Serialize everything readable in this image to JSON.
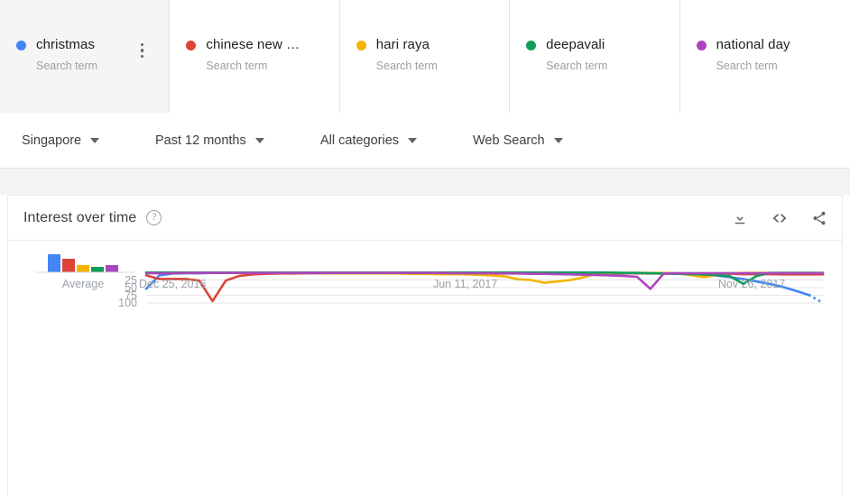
{
  "terms": [
    {
      "label": "christmas",
      "sub": "Search term",
      "color": "#4285F4",
      "selected": true,
      "menu_icon": "more-vert-icon"
    },
    {
      "label": "chinese new …",
      "sub": "Search term",
      "color": "#DB4437",
      "selected": false
    },
    {
      "label": "hari raya",
      "sub": "Search term",
      "color": "#F4B400",
      "selected": false
    },
    {
      "label": "deepavali",
      "sub": "Search term",
      "color": "#0F9D58",
      "selected": false
    },
    {
      "label": "national day",
      "sub": "Search term",
      "color": "#AB47BC",
      "selected": false
    }
  ],
  "filters": [
    {
      "label": "Singapore",
      "icon": "chevron-down-icon"
    },
    {
      "label": "Past 12 months",
      "icon": "chevron-down-icon"
    },
    {
      "label": "All categories",
      "icon": "chevron-down-icon"
    },
    {
      "label": "Web Search",
      "icon": "chevron-down-icon"
    }
  ],
  "chart_card": {
    "title": "Interest over time",
    "help_icon": "help-circle-icon",
    "tools": [
      {
        "name": "download-icon"
      },
      {
        "name": "embed-code-icon"
      },
      {
        "name": "share-icon"
      }
    ]
  },
  "chart_data": {
    "type": "line",
    "title": "Interest over time",
    "xlabel": "",
    "ylabel": "",
    "ylim": [
      0,
      100
    ],
    "yticks": [
      "25",
      "50",
      "75",
      "100"
    ],
    "ytick_values": [
      25,
      50,
      75,
      100
    ],
    "xticks": [
      "Dec 25, 2016",
      "Jun 11, 2017",
      "Nov 26, 2017"
    ],
    "xtick_index": [
      0,
      24,
      48
    ],
    "grid": true,
    "legend_position": "top",
    "partial_data_dashed_tail": true,
    "series": [
      {
        "name": "christmas",
        "color": "#4285F4",
        "values": [
          54,
          10,
          4,
          3,
          3,
          2,
          2,
          2,
          2,
          2,
          2,
          2,
          2,
          2,
          2,
          2,
          2,
          2,
          2,
          2,
          2,
          2,
          2,
          2,
          2,
          2,
          2,
          2,
          2,
          2,
          2,
          2,
          2,
          2,
          2,
          2,
          3,
          3,
          3,
          4,
          5,
          6,
          8,
          11,
          16,
          22,
          30,
          38,
          48,
          61,
          75,
          100
        ],
        "dashed_from_index": 50
      },
      {
        "name": "chinese new …",
        "color": "#DB4437",
        "values": [
          10,
          22,
          22,
          22,
          27,
          94,
          27,
          12,
          7,
          5,
          4,
          4,
          3,
          3,
          3,
          3,
          3,
          3,
          3,
          3,
          3,
          3,
          3,
          3,
          3,
          3,
          3,
          3,
          3,
          3,
          3,
          3,
          3,
          3,
          3,
          3,
          3,
          3,
          4,
          4,
          4,
          5,
          5,
          4,
          5,
          6,
          6,
          6,
          7,
          7,
          7,
          7
        ],
        "dashed_from_index": null
      },
      {
        "name": "hari raya",
        "color": "#F4B400",
        "values": [
          2,
          2,
          2,
          2,
          2,
          2,
          2,
          2,
          2,
          2,
          2,
          2,
          2,
          2,
          3,
          3,
          3,
          3,
          4,
          4,
          5,
          5,
          6,
          6,
          7,
          8,
          10,
          13,
          23,
          25,
          34,
          30,
          25,
          16,
          3,
          2,
          2,
          2,
          2,
          2,
          3,
          9,
          16,
          9,
          3,
          2,
          2,
          2,
          2,
          2,
          2,
          2
        ],
        "dashed_from_index": null
      },
      {
        "name": "deepavali",
        "color": "#0F9D58",
        "values": [
          1,
          1,
          1,
          1,
          1,
          1,
          1,
          1,
          1,
          1,
          1,
          1,
          1,
          1,
          1,
          1,
          1,
          1,
          1,
          1,
          1,
          1,
          1,
          1,
          1,
          1,
          1,
          1,
          1,
          1,
          1,
          1,
          1,
          1,
          1,
          1,
          2,
          2,
          3,
          4,
          5,
          6,
          7,
          9,
          13,
          38,
          12,
          2,
          2,
          2,
          2,
          2
        ],
        "dashed_from_index": null
      },
      {
        "name": "national day",
        "color": "#AB47BC",
        "values": [
          3,
          3,
          3,
          2,
          2,
          2,
          2,
          2,
          2,
          2,
          2,
          2,
          2,
          2,
          2,
          2,
          2,
          2,
          2,
          2,
          2,
          2,
          2,
          3,
          3,
          3,
          3,
          4,
          4,
          5,
          5,
          6,
          7,
          8,
          9,
          10,
          12,
          15,
          54,
          4,
          3,
          3,
          3,
          3,
          3,
          3,
          3,
          3,
          3,
          3,
          3,
          3
        ],
        "dashed_from_index": null
      }
    ],
    "average_bars": {
      "label": "Average",
      "categories": [
        "christmas",
        "chinese new …",
        "hari raya",
        "deepavali",
        "national day"
      ],
      "values": [
        20,
        15,
        8,
        6,
        8
      ],
      "colors": [
        "#4285F4",
        "#DB4437",
        "#F4B400",
        "#0F9D58",
        "#AB47BC"
      ]
    }
  }
}
